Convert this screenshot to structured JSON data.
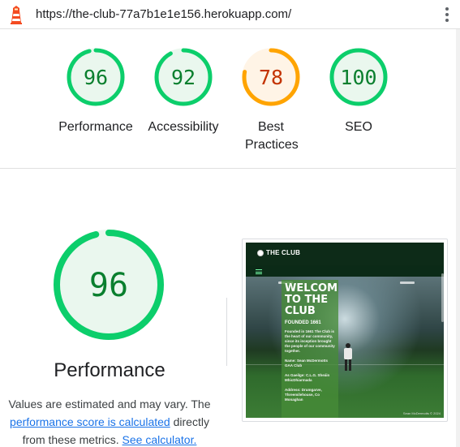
{
  "browser": {
    "url": "https://the-club-77a7b1e1e156.herokuapp.com/"
  },
  "colors": {
    "pass_green": "#0cce6b",
    "pass_text": "#0a7f2e",
    "pass_fill": "#eaf7ee",
    "average_orange": "#ffa400",
    "average_text": "#c33300",
    "average_fill": "#fff4e6",
    "link_blue": "#1a73e8"
  },
  "scores": [
    {
      "id": "performance",
      "label": "Performance",
      "value": 96,
      "rating": "pass"
    },
    {
      "id": "accessibility",
      "label": "Accessibility",
      "value": 92,
      "rating": "pass"
    },
    {
      "id": "best-practices",
      "label": "Best Practices",
      "value": 78,
      "rating": "average"
    },
    {
      "id": "seo",
      "label": "SEO",
      "value": 100,
      "rating": "pass"
    }
  ],
  "detail": {
    "score": 96,
    "title": "Performance",
    "note_text_1": "Values are estimated and may vary. The ",
    "note_link_1": "performance score is calculated",
    "note_text_2": " directly from these metrics. ",
    "note_link_2": "See calculator."
  },
  "thumbnail": {
    "brand": "THE CLUB",
    "heading": "WELCOME TO THE CLUB",
    "founded": "FOUNDED 1661",
    "paragraph": "Founded in 1661 The Club is the heart of our community, since its inception brought the people of our community together.",
    "name_line": "Name: Sean McDermotts GAA Club",
    "gaeilge_line": "As Gaeilge: C.L.G. Sheáin MhicDhiarmada",
    "address_line": "Address: Drumgarve, Threemilehouse, Co Monaghan",
    "footer": "Sean McDermotts © 2024"
  }
}
